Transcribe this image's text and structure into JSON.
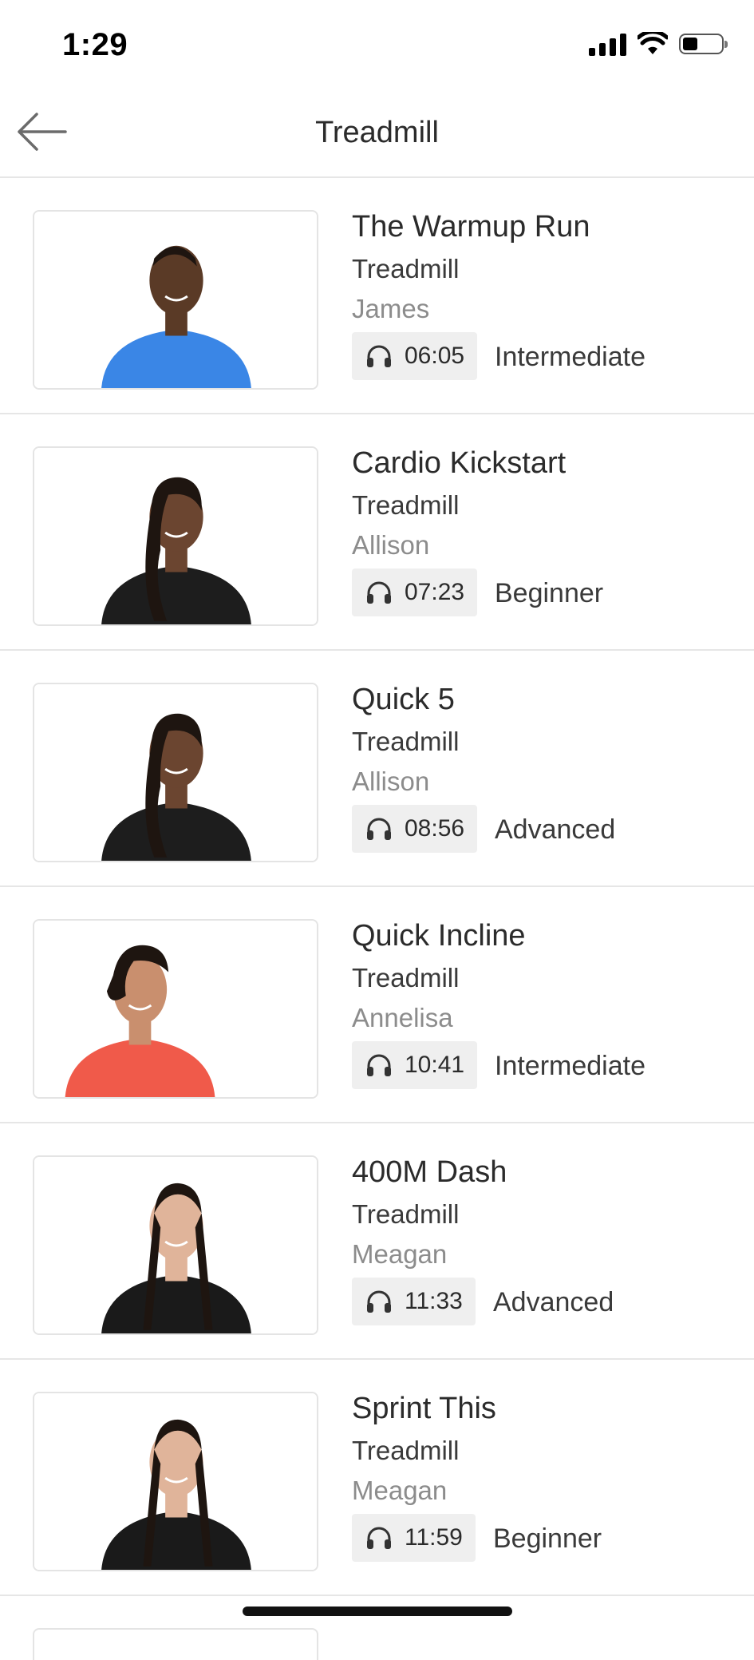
{
  "status": {
    "time": "1:29",
    "battery_level": 0.35
  },
  "header": {
    "title": "Treadmill",
    "back_icon": "arrow-left-icon"
  },
  "workouts": [
    {
      "title": "The Warmup Run",
      "category": "Treadmill",
      "instructor": "James",
      "duration": "06:05",
      "level": "Intermediate",
      "trainer_style": "man-blue-shirt"
    },
    {
      "title": "Cardio Kickstart",
      "category": "Treadmill",
      "instructor": "Allison",
      "duration": "07:23",
      "level": "Beginner",
      "trainer_style": "woman-ponytail-black-top"
    },
    {
      "title": "Quick 5",
      "category": "Treadmill",
      "instructor": "Allison",
      "duration": "08:56",
      "level": "Advanced",
      "trainer_style": "woman-ponytail-black-top"
    },
    {
      "title": "Quick Incline",
      "category": "Treadmill",
      "instructor": "Annelisa",
      "duration": "10:41",
      "level": "Intermediate",
      "trainer_style": "woman-red-top"
    },
    {
      "title": "400M Dash",
      "category": "Treadmill",
      "instructor": "Meagan",
      "duration": "11:33",
      "level": "Advanced",
      "trainer_style": "woman-braids-black-top"
    },
    {
      "title": "Sprint This",
      "category": "Treadmill",
      "instructor": "Meagan",
      "duration": "11:59",
      "level": "Beginner",
      "trainer_style": "woman-braids-black-top"
    }
  ],
  "colors": {
    "divider": "#e6e6e6",
    "chip_bg": "#efefef",
    "instructor_text": "#8c8c8c"
  }
}
